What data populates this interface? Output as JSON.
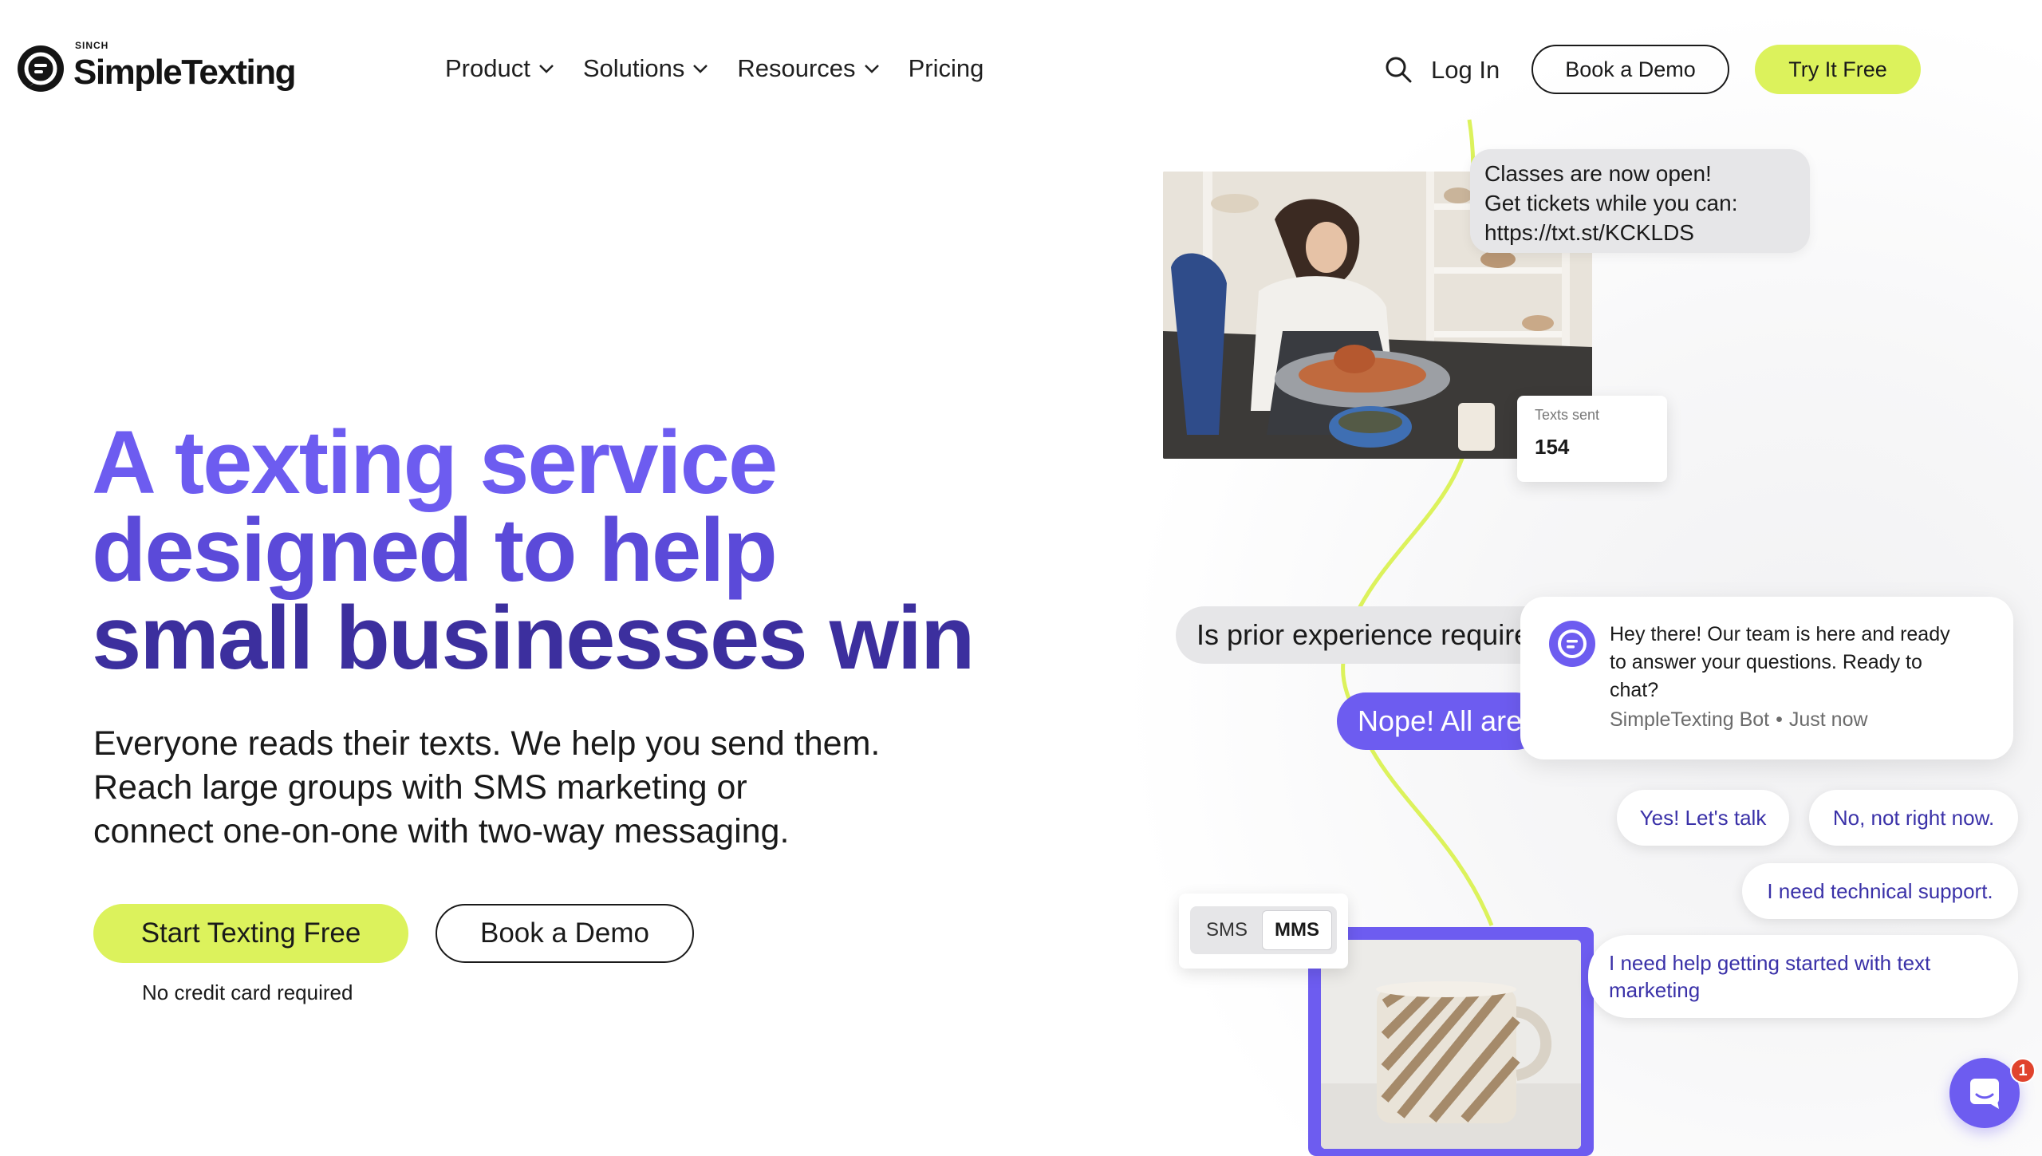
{
  "header": {
    "logo_small": "SINCH",
    "logo_name": "SimpleTexting",
    "nav": [
      {
        "label": "Product",
        "has_dropdown": true
      },
      {
        "label": "Solutions",
        "has_dropdown": true
      },
      {
        "label": "Resources",
        "has_dropdown": true
      },
      {
        "label": "Pricing",
        "has_dropdown": false
      }
    ],
    "search_icon": "search-icon",
    "login_label": "Log In",
    "book_demo_label": "Book a Demo",
    "try_free_label": "Try It Free"
  },
  "hero": {
    "title_lines": [
      "A texting service",
      "designed to help",
      "small businesses win"
    ],
    "subtitle_lines": [
      "Everyone reads their texts. We help you send them.",
      "Reach large groups with SMS marketing or",
      "connect one-on-one with two-way messaging."
    ],
    "start_label": "Start Texting Free",
    "book_demo_label": "Book a Demo",
    "note": "No credit card required"
  },
  "collage": {
    "classes_bubble_lines": [
      "Classes are now open!",
      "Get tickets while you can:",
      "https://txt.st/KCKLDS"
    ],
    "texts_sent_label": "Texts sent",
    "texts_sent_value": "154",
    "prior_bubble": "Is prior experience required?",
    "nope_bubble": "Nope! All are welcome.",
    "toggle": {
      "sms": "SMS",
      "mms": "MMS",
      "selected": "MMS"
    }
  },
  "chat": {
    "message_lines": [
      "Hey there! Our team is here and ready",
      "to answer your questions. Ready to",
      "chat?"
    ],
    "sender": "SimpleTexting Bot",
    "time": "Just now",
    "replies": {
      "yes": "Yes! Let's talk",
      "no": "No, not right now.",
      "tech": "I need technical support.",
      "help_lines": [
        "I need help getting started with text",
        "marketing"
      ]
    },
    "unread_count": "1"
  },
  "colors": {
    "accent_lime": "#dcf25c",
    "brand_purple": "#6d5cf0",
    "title_purple_dark": "#3c2f9e",
    "bubble_gray": "#e6e6e8"
  }
}
